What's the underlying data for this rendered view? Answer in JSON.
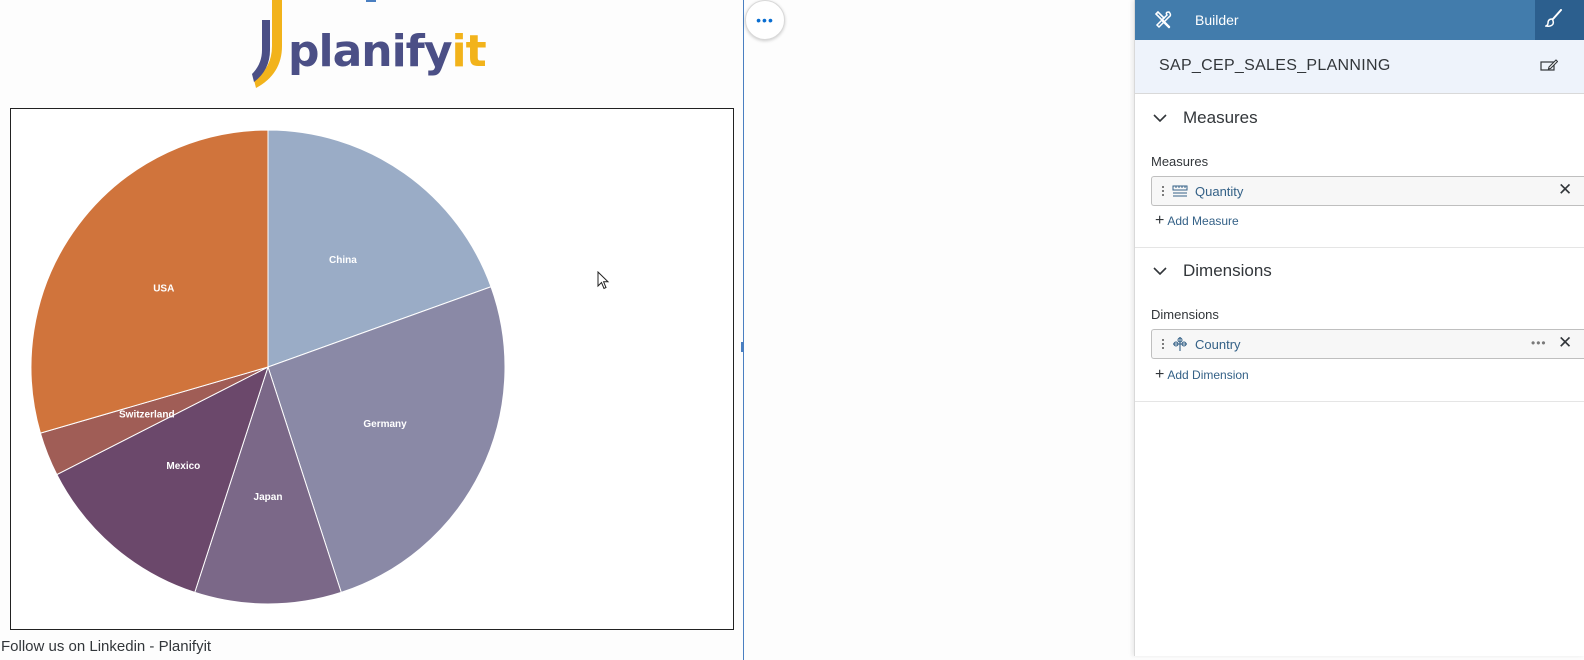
{
  "logo": {
    "text_main": "planify",
    "text_accent": "it",
    "colors": {
      "main": "#4b4f86",
      "accent": "#f2b31b"
    }
  },
  "canvas": {
    "more_button_label": "•••",
    "footer_link": "Follow us on Linkedin - Planifyit"
  },
  "chart_data": {
    "type": "pie",
    "categories": [
      "China",
      "Germany",
      "Japan",
      "Mexico",
      "Switzerland",
      "USA"
    ],
    "values": [
      19.5,
      25.5,
      10.0,
      12.5,
      3.0,
      29.5
    ],
    "colors": [
      "#9aacc6",
      "#8a89a6",
      "#7b6888",
      "#6b486b",
      "#a05d56",
      "#d0743c"
    ],
    "start_angle_deg": 0,
    "label_color": "#ffffff"
  },
  "panel": {
    "builder_tab_label": "Builder",
    "builder_icon": "tools-icon",
    "styling_icon": "paintbrush-icon",
    "model_name": "SAP_CEP_SALES_PLANNING",
    "accent_color": "#427cac",
    "measures": {
      "section_title": "Measures",
      "field_label": "Measures",
      "token_label": "Quantity",
      "token_icon": "ruler-icon",
      "add_label": "Add Measure"
    },
    "dimensions": {
      "section_title": "Dimensions",
      "field_label": "Dimensions",
      "token_label": "Country",
      "token_icon": "dimension-icon",
      "token_more": "•••",
      "add_label": "Add Dimension"
    }
  }
}
